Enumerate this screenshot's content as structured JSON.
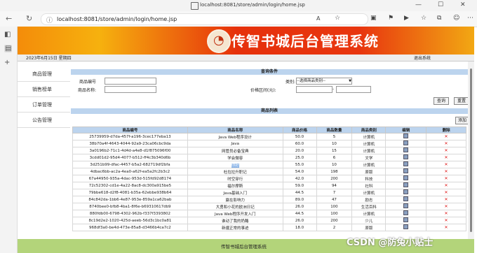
{
  "browser": {
    "window_title": "localhost:8081/store/admin/login/home.jsp",
    "address": "localhost:8081/store/admin/login/home.jsp"
  },
  "header": {
    "title": "传智书城后台管理系统",
    "date": "2023年6月15日 星期四",
    "logout": "退出系统"
  },
  "sidebar": {
    "items": [
      {
        "label": "商品管理"
      },
      {
        "label": "销售榜单"
      },
      {
        "label": "订单管理"
      },
      {
        "label": "公告管理"
      }
    ]
  },
  "search": {
    "heading": "查询条件",
    "id_label": "商品编号",
    "name_label": "商品名称:",
    "category_label": "类别:",
    "category_value": "--选择商品类别--",
    "price_label": "价格区间(元):",
    "price_sep": "-",
    "query_button": "查询",
    "reset_button": "重置"
  },
  "list": {
    "heading": "商品列表",
    "add_button": "添加",
    "columns": [
      "商品编号",
      "商品名称",
      "商品价格",
      "商品数量",
      "商品类别",
      "编辑",
      "删除"
    ],
    "rows": [
      [
        "25739959-d7da-457f-a196-3cec177eba13",
        "Java Web程序设计",
        "50.0",
        "5",
        "计算机"
      ],
      [
        "38b70a4f-4643-4044-92a9-23ca06cbc9da",
        "Java",
        "60.0",
        "10",
        "计算机"
      ],
      [
        "3a0196b2-71c1-4d4d-a4e8-d1f875096f00",
        "网管员必备宝典",
        "20.0",
        "15",
        "计算机"
      ],
      [
        "3cdd01d2-95d4-4077-b512-ff4c3b340d6b",
        "学会微容",
        "25.0",
        "6",
        "文学"
      ],
      [
        "3d251b99-dfac-4457-b5a2-682719df2bfa",
        "你好",
        "55.0",
        "10",
        "计算机"
      ],
      [
        "4dbac6bb-ac2a-4ea0-a62f-ea5a2fc2b3c2",
        "杜拉拉升职记",
        "54.0",
        "198",
        "原版"
      ],
      [
        "67a44950-935a-4dac-953d-515fd92d8174",
        "时空穿行",
        "42.0",
        "200",
        "科技"
      ],
      [
        "72c52302-cd1e-4a22-8ac8-dc300a915be5",
        "福尔摩斯",
        "59.0",
        "94",
        "社科"
      ],
      [
        "79bbe618-d2f8-4081-b35a-62ebbe938b64",
        "Java基础入门",
        "44.5",
        "7",
        "计算机"
      ],
      [
        "84c842da-1bb6-4e87-953e-859a1ca62bab",
        "赢在影响力",
        "89.0",
        "47",
        "励志"
      ],
      [
        "8740bee0-bfb8-4ba1-8f6e-b69310617db9",
        "大勇和小花的欧洲日记",
        "26.0",
        "100",
        "生活百科"
      ],
      [
        "880fdb00-6798-4302-962b-f337f3393802",
        "Java Web程序开发入门",
        "44.5",
        "100",
        "计算机"
      ],
      [
        "8c19d2e2-1020-425d-aeeb-56d3c1bc0a81",
        "谁动了我的奶酪",
        "26.0",
        "200",
        "少儿"
      ],
      [
        "968df3a0-be4d-473e-85a8-d3466b4ca7c2",
        "新疆正常的事迹",
        "18.0",
        "2",
        "原版"
      ]
    ]
  },
  "footer": {
    "text": "传智书城后台管理系统"
  },
  "watermark": "CSDN @防兔小贴士",
  "colors": {
    "banner_start": "#f48c0a",
    "banner_mid": "#e6310c",
    "section_header": "#bcd4ee",
    "footer": "#b3d47a",
    "delete": "#dd1111"
  }
}
